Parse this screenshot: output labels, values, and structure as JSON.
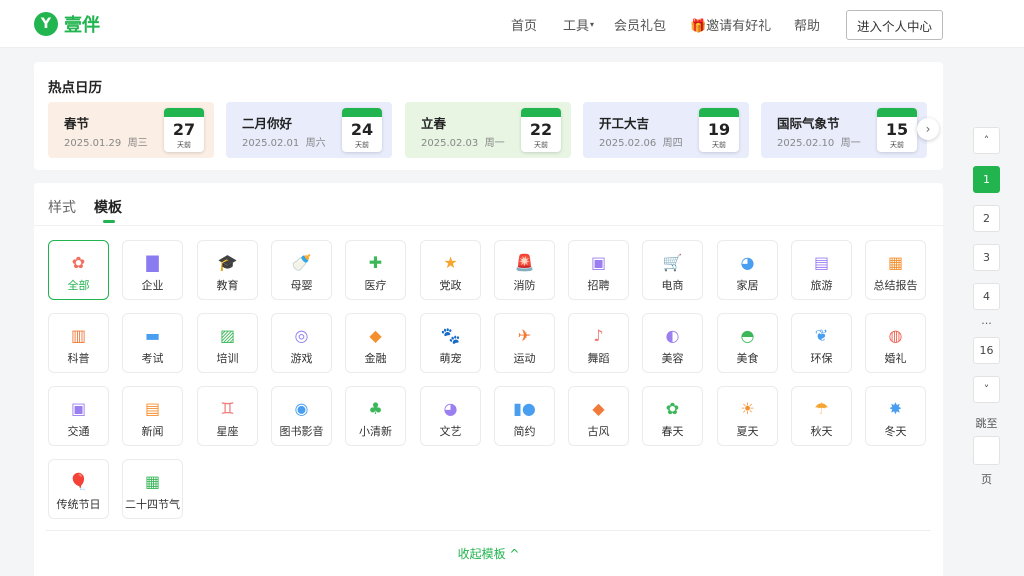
{
  "header": {
    "logo_mark": "Y",
    "logo_text": "壹伴",
    "nav": [
      {
        "label": "首页",
        "name": "nav-home"
      },
      {
        "label": "工具",
        "name": "nav-tools",
        "caret": "▾"
      },
      {
        "label": "会员礼包",
        "name": "nav-member-gift"
      },
      {
        "label": "🎁邀请有好礼",
        "name": "nav-invite"
      },
      {
        "label": "帮助",
        "name": "nav-help"
      }
    ],
    "enter_button": "进入个人中心"
  },
  "calendar": {
    "title": "热点日历",
    "next_icon": "›",
    "items": [
      {
        "name": "春节",
        "date": "2025.01.29",
        "weekday": "周三",
        "days": "27",
        "unit": "天前",
        "bg": "#fbeee4"
      },
      {
        "name": "二月你好",
        "date": "2025.02.01",
        "weekday": "周六",
        "days": "24",
        "unit": "天前",
        "bg": "#e8ecfb"
      },
      {
        "name": "立春",
        "date": "2025.02.03",
        "weekday": "周一",
        "days": "22",
        "unit": "天前",
        "bg": "#e8f5e3"
      },
      {
        "name": "开工大吉",
        "date": "2025.02.06",
        "weekday": "周四",
        "days": "19",
        "unit": "天前",
        "bg": "#e8ecfb"
      },
      {
        "name": "国际气象节",
        "date": "2025.02.10",
        "weekday": "周一",
        "days": "15",
        "unit": "天前",
        "bg": "#e8ecfb"
      }
    ]
  },
  "templates": {
    "tabs": [
      {
        "label": "样式",
        "active": false
      },
      {
        "label": "模板",
        "active": true
      }
    ],
    "categories": [
      {
        "label": "全部",
        "icon": "✿",
        "color": "#f07060",
        "active": true
      },
      {
        "label": "企业",
        "icon": "▇",
        "color": "#8a7cf0"
      },
      {
        "label": "教育",
        "icon": "🎓",
        "color": "#f5903a"
      },
      {
        "label": "母婴",
        "icon": "🍼",
        "color": "#f07a7a"
      },
      {
        "label": "医疗",
        "icon": "✚",
        "color": "#3cb85a"
      },
      {
        "label": "党政",
        "icon": "★",
        "color": "#f5a530"
      },
      {
        "label": "消防",
        "icon": "🚨",
        "color": "#f06050"
      },
      {
        "label": "招聘",
        "icon": "▣",
        "color": "#9b7ef0"
      },
      {
        "label": "电商",
        "icon": "🛒",
        "color": "#f59030"
      },
      {
        "label": "家居",
        "icon": "◕",
        "color": "#4a9ef0"
      },
      {
        "label": "旅游",
        "icon": "▤",
        "color": "#9b7ef0"
      },
      {
        "label": "总结报告",
        "icon": "▦",
        "color": "#f59030"
      },
      {
        "label": "科普",
        "icon": "▥",
        "color": "#f07a3a"
      },
      {
        "label": "考试",
        "icon": "▬",
        "color": "#4a9ef0"
      },
      {
        "label": "培训",
        "icon": "▨",
        "color": "#3cb85a"
      },
      {
        "label": "游戏",
        "icon": "◎",
        "color": "#8a7cf0"
      },
      {
        "label": "金融",
        "icon": "◆",
        "color": "#f59030"
      },
      {
        "label": "萌宠",
        "icon": "🐾",
        "color": "#3cb85a"
      },
      {
        "label": "运动",
        "icon": "✈",
        "color": "#f07a3a"
      },
      {
        "label": "舞蹈",
        "icon": "♪",
        "color": "#f07a7a"
      },
      {
        "label": "美容",
        "icon": "◐",
        "color": "#9b7ef0"
      },
      {
        "label": "美食",
        "icon": "◓",
        "color": "#3cb85a"
      },
      {
        "label": "环保",
        "icon": "❦",
        "color": "#4a9ef0"
      },
      {
        "label": "婚礼",
        "icon": "◍",
        "color": "#f06050"
      },
      {
        "label": "交通",
        "icon": "▣",
        "color": "#9b7ef0"
      },
      {
        "label": "新闻",
        "icon": "▤",
        "color": "#f59030"
      },
      {
        "label": "星座",
        "icon": "♊",
        "color": "#f07a7a"
      },
      {
        "label": "图书影音",
        "icon": "◉",
        "color": "#4a9ef0"
      },
      {
        "label": "小清新",
        "icon": "♣",
        "color": "#3cb85a"
      },
      {
        "label": "文艺",
        "icon": "◕",
        "color": "#9b7ef0"
      },
      {
        "label": "简约",
        "icon": "▮●",
        "color": "#4a9ef0"
      },
      {
        "label": "古风",
        "icon": "◆",
        "color": "#f07a3a"
      },
      {
        "label": "春天",
        "icon": "✿",
        "color": "#3cb85a"
      },
      {
        "label": "夏天",
        "icon": "☀",
        "color": "#f59030"
      },
      {
        "label": "秋天",
        "icon": "☂",
        "color": "#f5a530"
      },
      {
        "label": "冬天",
        "icon": "✸",
        "color": "#4a9ef0"
      },
      {
        "label": "传统节日",
        "icon": "🎈",
        "color": "#f06050"
      },
      {
        "label": "二十四节气",
        "icon": "▦",
        "color": "#3cb85a"
      }
    ],
    "collapse_label": "收起模板 ^"
  },
  "pager": {
    "up": "˄",
    "pages": [
      "1",
      "2",
      "3",
      "4"
    ],
    "ellipsis": "...",
    "last": "16",
    "down": "˅",
    "jump_label": "跳至",
    "page_label": "页",
    "current": "1"
  },
  "colors": {
    "accent": "#21b44f"
  }
}
